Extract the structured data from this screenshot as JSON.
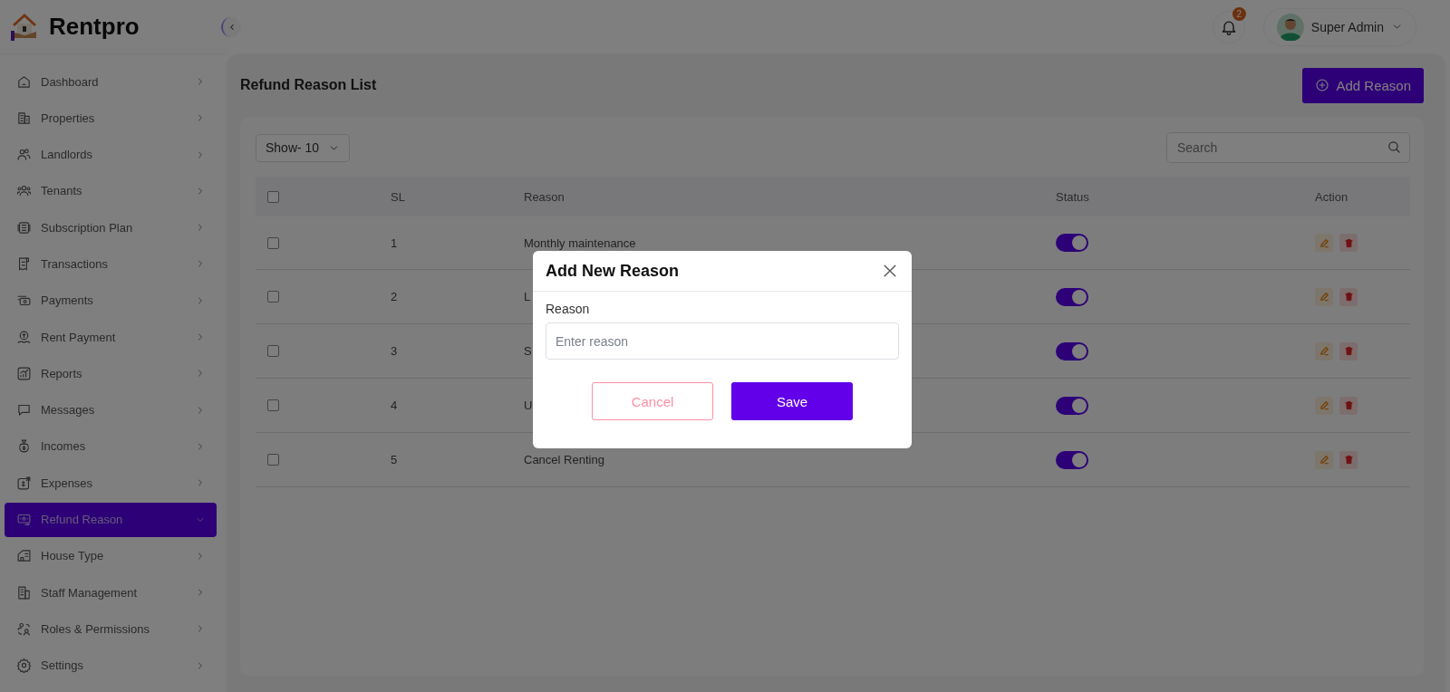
{
  "brand": {
    "name": "Rentpro"
  },
  "sidebar": {
    "items": [
      {
        "label": "Dashboard",
        "selected": false
      },
      {
        "label": "Properties",
        "selected": false
      },
      {
        "label": "Landlords",
        "selected": false
      },
      {
        "label": "Tenants",
        "selected": false
      },
      {
        "label": "Subscription Plan",
        "selected": false
      },
      {
        "label": "Transactions",
        "selected": false
      },
      {
        "label": "Payments",
        "selected": false
      },
      {
        "label": "Rent Payment",
        "selected": false
      },
      {
        "label": "Reports",
        "selected": false
      },
      {
        "label": "Messages",
        "selected": false
      },
      {
        "label": "Incomes",
        "selected": false
      },
      {
        "label": "Expenses",
        "selected": false
      },
      {
        "label": "Refund Reason",
        "selected": true
      },
      {
        "label": "House Type",
        "selected": false
      },
      {
        "label": "Staff Management",
        "selected": false
      },
      {
        "label": "Roles & Permissions",
        "selected": false
      },
      {
        "label": "Settings",
        "selected": false
      }
    ]
  },
  "header": {
    "notification_count": "2",
    "user": "Super Admin"
  },
  "page": {
    "title": "Refund Reason List",
    "add_button": "Add Reason"
  },
  "toolbar": {
    "show": "Show- 10",
    "search_placeholder": "Search"
  },
  "table": {
    "select_all_checked": false,
    "columns": [
      "SL",
      "Reason",
      "Status",
      "Action"
    ],
    "rows": [
      {
        "checked": false,
        "sl": "1",
        "reason": "Monthly maintenance",
        "on": true
      },
      {
        "checked": false,
        "sl": "2",
        "reason": "L",
        "on": true
      },
      {
        "checked": false,
        "sl": "3",
        "reason": "S",
        "on": true
      },
      {
        "checked": false,
        "sl": "4",
        "reason": "U",
        "on": true
      },
      {
        "checked": false,
        "sl": "5",
        "reason": "Cancel Renting",
        "on": true
      }
    ]
  },
  "modal": {
    "title": "Add New Reason",
    "field_label": "Reason",
    "placeholder": "Enter reason",
    "cancel": "Cancel",
    "save": "Save"
  }
}
